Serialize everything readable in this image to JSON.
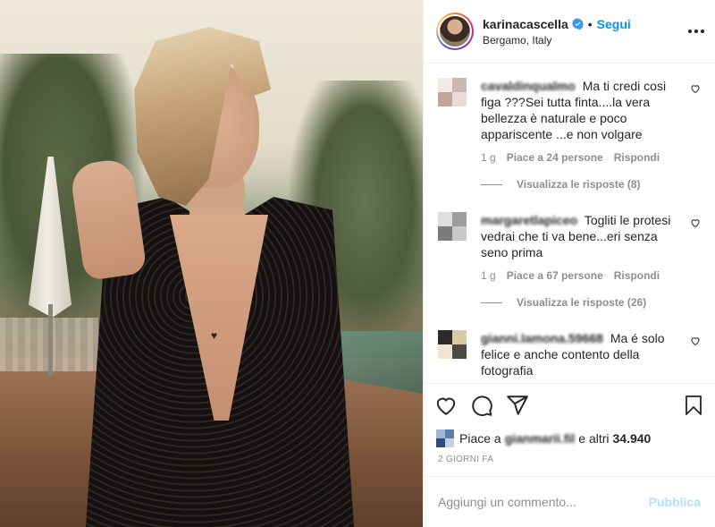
{
  "header": {
    "username": "karinacascella",
    "separator": "•",
    "follow_label": "Segui",
    "location": "Bergamo, Italy"
  },
  "comments": [
    {
      "username": "cavaldinqualmo",
      "text": "Ma ti credi cosi figa ???Sei tutta finta....la vera bellezza è naturale e poco appariscente ...e non volgare",
      "time": "1 g",
      "likes": "Piace a 24 persone",
      "reply_label": "Rispondi",
      "replies_label": "Visualizza le risposte (8)"
    },
    {
      "username": "margaretlapiceo",
      "text": "Togliti le protesi vedrai che ti va bene...eri senza seno prima",
      "time": "1 g",
      "likes": "Piace a 67 persone",
      "reply_label": "Rispondi",
      "replies_label": "Visualizza le risposte (26)"
    },
    {
      "username": "gianni.lamona.59668",
      "text": "Ma é solo felice e anche contento della fotografia"
    }
  ],
  "likes": {
    "prefix": "Piace a",
    "user": "gianmarii.fil",
    "suffix": "e altri",
    "count": "34.940"
  },
  "timestamp": "2 GIORNI FA",
  "add_comment": {
    "placeholder": "Aggiungi un commento...",
    "publish_label": "Pubblica"
  },
  "colors": {
    "accent": "#0095f6",
    "publish_disabled": "#b2dffc",
    "muted": "#8e8e8e",
    "text": "#262626"
  },
  "icons": {
    "verified": "verified-badge-icon",
    "more": "more-options-icon",
    "like": "heart-icon",
    "comment": "comment-bubble-icon",
    "share": "paper-plane-icon",
    "save": "bookmark-icon"
  }
}
